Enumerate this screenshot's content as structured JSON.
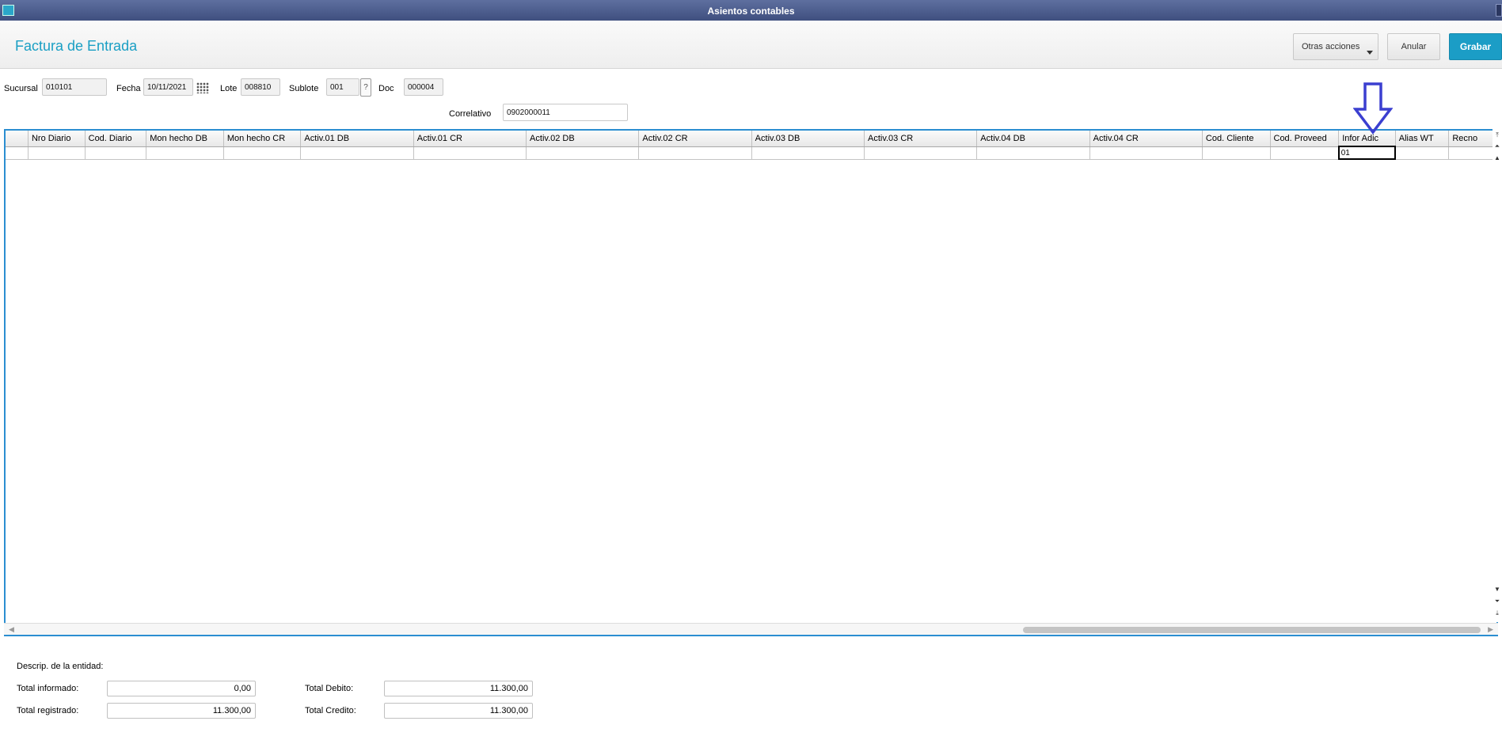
{
  "window": {
    "title": "Asientos contables",
    "icon": "window-app-icon"
  },
  "header": {
    "page_title": "Factura de Entrada",
    "otras_label": "Otras acciones",
    "anular_label": "Anular",
    "grabar_label": "Grabar",
    "accent_color": "#1b9dc6"
  },
  "form": {
    "sucursal": {
      "label": "Sucursal",
      "value": "010101"
    },
    "fecha": {
      "label": "Fecha",
      "value": "10/11/2021"
    },
    "lote": {
      "label": "Lote",
      "value": "008810"
    },
    "sublote": {
      "label": "Sublote",
      "value": "001",
      "lookup": "?"
    },
    "doc": {
      "label": "Doc",
      "value": "000004"
    },
    "correlativo": {
      "label": "Correlativo",
      "value": "0902000011"
    }
  },
  "grid": {
    "columns": [
      "",
      "Nro Diario",
      "Cod. Diario",
      "Mon hecho DB",
      "Mon hecho CR",
      "Activ.01 DB",
      "Activ.01 CR",
      "Activ.02 DB",
      "Activ.02 CR",
      "Activ.03 DB",
      "Activ.03 CR",
      "Activ.04 DB",
      "Activ.04 CR",
      "Cod. Cliente",
      "Cod. Proveed",
      "Infor Adic",
      "Alias WT",
      "Recno"
    ],
    "rows": [
      [
        "",
        "",
        "",
        "",
        "",
        "",
        "",
        "",
        "",
        "",
        "",
        "",
        "",
        "",
        "",
        "01",
        "",
        ""
      ]
    ],
    "editing_column": "Infor Adic",
    "annotation_color": "#3b3fd0"
  },
  "footer": {
    "descrip_label": "Descrip. de la entidad:",
    "total_informado": {
      "label": "Total informado:",
      "value": "0,00"
    },
    "total_registrado": {
      "label": "Total registrado:",
      "value": "11.300,00"
    },
    "total_debito": {
      "label": "Total Debito:",
      "value": "11.300,00"
    },
    "total_credito": {
      "label": "Total Credito:",
      "value": "11.300,00"
    }
  }
}
